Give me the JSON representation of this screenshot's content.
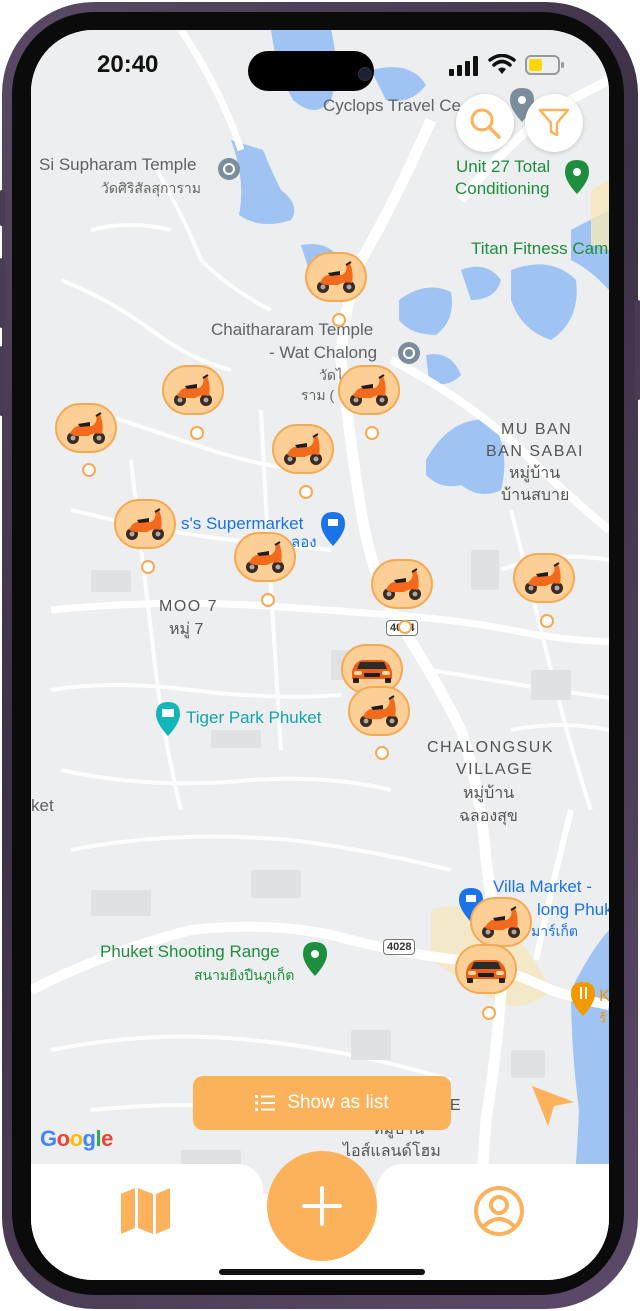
{
  "status_bar": {
    "time": "20:40"
  },
  "map": {
    "places": [
      {
        "id": "cyclops",
        "name": "Cyclops Travel Ce"
      },
      {
        "id": "si_supharam",
        "name": "Si Supharam Temple",
        "thai": "วัดศิริสัลสุการาม"
      },
      {
        "id": "unit27",
        "name": "Unit 27 Total",
        "name2": "Conditioning"
      },
      {
        "id": "titan",
        "name": "Titan Fitness Cam"
      },
      {
        "id": "chaithararam",
        "name": "Chaithararam Temple",
        "name2": "- Wat Chalong",
        "thai": "วัดไ",
        "thai2": "ราม ("
      },
      {
        "id": "mu_ban_sabai",
        "name": "MU BAN",
        "name2": "BAN SABAI",
        "thai": "หมู่บ้าน",
        "thai2": "บ้านสบาย"
      },
      {
        "id": "supermarket",
        "name": "s's Supermarket",
        "name2": "ลอง"
      },
      {
        "id": "moo7",
        "name": "MOO 7",
        "thai": "หมู่ 7"
      },
      {
        "id": "tiger_park",
        "name": "Tiger Park Phuket"
      },
      {
        "id": "chalongsuk",
        "name": "CHALONGSUK",
        "name2": "VILLAGE",
        "thai": "หมู่บ้าน",
        "thai2": "ฉลองสุข"
      },
      {
        "id": "ket",
        "name": "ket"
      },
      {
        "id": "villa_market",
        "name": "Villa Market -",
        "name2": "long Phuke",
        "thai": "มาร์เก็ต"
      },
      {
        "id": "shooting",
        "name": "Phuket Shooting Range",
        "thai": "สนามยิงปืนภูเก็ต"
      },
      {
        "id": "ame",
        "name": "ME",
        "thai": "หมู่บ้าน",
        "thai2": "ไอส์แลนด์โฮม"
      },
      {
        "id": "k_rest",
        "name": "K",
        "thai": "ร้"
      }
    ],
    "road_shields": [
      "4024",
      "4028"
    ],
    "attribution": "Google"
  },
  "markers": [
    {
      "kind": "scooter"
    },
    {
      "kind": "scooter"
    },
    {
      "kind": "scooter"
    },
    {
      "kind": "scooter"
    },
    {
      "kind": "scooter"
    },
    {
      "kind": "scooter"
    },
    {
      "kind": "scooter"
    },
    {
      "kind": "scooter"
    },
    {
      "kind": "scooter"
    },
    {
      "kind": "car"
    },
    {
      "kind": "scooter"
    },
    {
      "kind": "scooter"
    },
    {
      "kind": "car"
    }
  ],
  "toolbar": {
    "search_icon": "search-icon",
    "filter_icon": "filter-icon"
  },
  "list_button": {
    "label": "Show as list",
    "icon": "list-icon"
  },
  "nav": {
    "map_icon": "map-icon",
    "add_icon": "plus-icon",
    "profile_icon": "user-icon"
  },
  "colors": {
    "accent": "#fbb25b",
    "marker_fill": "#fbcf96",
    "marker_border": "#f6a953",
    "water": "#9fc3f3"
  }
}
